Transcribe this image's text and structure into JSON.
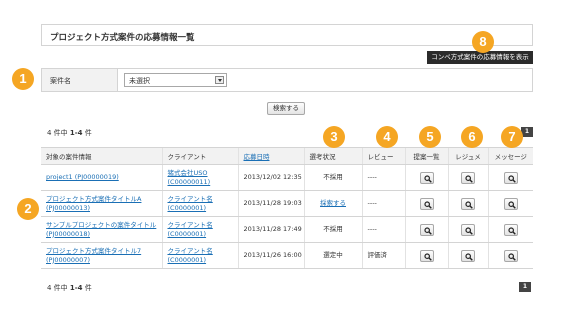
{
  "page_title": "プロジェクト方式案件の応募情報一覧",
  "contest_button": "コンペ方式案件の応募情報を表示",
  "filter": {
    "label": "案件名",
    "select_value": "未選択"
  },
  "search_button": "検索する",
  "count_top": {
    "pre": "4 件中 ",
    "range": "1-4",
    "post": " 件"
  },
  "count_bottom": {
    "pre": "4 件中 ",
    "range": "1-4",
    "post": " 件"
  },
  "pager_label": "1",
  "table": {
    "headers": [
      "対象の案件情報",
      "クライアント",
      "応募日時",
      "選考状況",
      "レビュー",
      "提案一覧",
      "レジュメ",
      "メッセージ"
    ],
    "rows": [
      {
        "project": "project1 (PJ00000019)",
        "client": "猪式会社USO (C00000011)",
        "date": "2013/12/02 12:35",
        "status": "不採用",
        "status_link": false,
        "review": "----"
      },
      {
        "project": "プロジェクト方式案件タイトルA (PJ00000013)",
        "client": "クライアント名 (C0000001)",
        "date": "2013/11/28 19:03",
        "status": "採索する",
        "status_link": true,
        "review": "----"
      },
      {
        "project": "サンプルプロジェクトの案件タイトル (PJ00000018)",
        "client": "クライアント名 (C0000001)",
        "date": "2013/11/28 17:49",
        "status": "不採用",
        "status_link": false,
        "review": "----"
      },
      {
        "project": "プロジェクト方式案件タイトル7 (PJ00000007)",
        "client": "クライアント名 (C0000001)",
        "date": "2013/11/26 16:00",
        "status": "選定中",
        "status_link": false,
        "review": "評価済"
      }
    ]
  },
  "callouts": [
    "1",
    "2",
    "3",
    "4",
    "5",
    "6",
    "7",
    "8"
  ],
  "colors": {
    "callout": "#f5a623",
    "link": "#1a6fb5",
    "header_bg": "#f2f2f2",
    "dark_button": "#2b2b2b"
  },
  "icons": {
    "view": "magnifier-icon",
    "dropdown": "chevron-down-icon"
  }
}
